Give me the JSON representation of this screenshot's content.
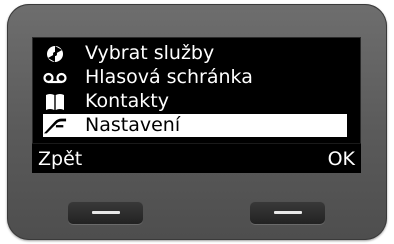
{
  "menu": {
    "items": [
      {
        "label": "Vybrat služby",
        "icon": "services-icon",
        "selected": false
      },
      {
        "label": "Hlasová schránka",
        "icon": "voicemail-icon",
        "selected": false
      },
      {
        "label": "Kontakty",
        "icon": "book-icon",
        "selected": false
      },
      {
        "label": "Nastavení",
        "icon": "settings-wrench-icon",
        "selected": true
      }
    ]
  },
  "softkeys": {
    "left_label": "Zpět",
    "right_label": "OK"
  },
  "colors": {
    "screen_bg": "#000000",
    "text": "#ffffff",
    "selection_bg": "#ffffff",
    "selection_text": "#000000",
    "housing": "#5f5f5f"
  }
}
